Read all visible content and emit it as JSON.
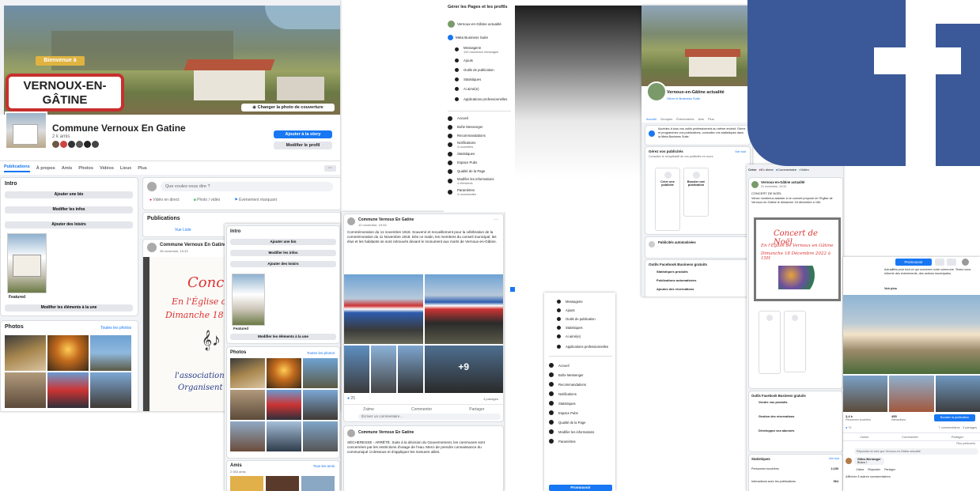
{
  "cover": {
    "welcome_sign": "Bienvenue à",
    "town_sign": "VERNOUX-EN-GÂTINE",
    "change_cover_btn": "Changer la photo de couverture"
  },
  "page1": {
    "page_name": "Commune Vernoux En Gatine",
    "likes": "2 k amis",
    "btn_story": "Ajouter à la story",
    "btn_edit": "Modifier le profil",
    "tabs": [
      "Publications",
      "À propos",
      "Amis",
      "Photos",
      "Vidéos",
      "Lieux",
      "Plus"
    ],
    "intro_title": "Intro",
    "intro_btns": [
      "Ajouter une bio",
      "Modifier les infos",
      "Ajouter des loisirs"
    ],
    "featured_label": "Featured",
    "featured_btn": "Modifier les éléments à la une",
    "photos_title": "Photos",
    "photos_link": "Toutes les photos",
    "composer_placeholder": "Que voulez-vous dire ?",
    "composer_actions": [
      "Vidéo en direct",
      "Photo / vidéo",
      "Évènement marquant"
    ],
    "publications_title": "Publications",
    "list_view": "Vue Liste",
    "post_author": "Commune Vernoux En Gatine",
    "post_date": "28 novembre, 19:33"
  },
  "flyer": {
    "title": "Concert de Noël",
    "line1": "En l'Église de Vernoux en Gâtine",
    "line2": "Dimanche 18 Décembre 2022 à 15H",
    "assoc": "l'association TOGAS",
    "organise": "Organisent ce concert"
  },
  "page2": {
    "intro_title": "Intro",
    "intro_btns": [
      "Ajouter une bio",
      "Modifier les infos",
      "Ajouter des loisirs"
    ],
    "featured_label": "Featured",
    "featured_btn": "Modifier les éléments à la une",
    "photos_title": "Photos",
    "photos_link": "Toutes les photos",
    "friends_title": "Amis",
    "friends_count": "2 063 amis",
    "friends_link": "Tous les amis"
  },
  "post3": {
    "author": "Commune Vernoux En Gatine",
    "date": "12 novembre, 19:33",
    "body": "Commémoration du 11 novembre 1918. Souvenir et recueillement pour la célébration de la commémoration du 11 Novembre 1918. Dès ce matin, les membres du conseil municipal, les élus et les habitants se sont retrouvés devant le monument aux morts de Vernoux-en-Gâtine.",
    "more_photos": "+9",
    "reactions": "25",
    "shares": "3 partages",
    "actions": [
      "J'aime",
      "Commenter",
      "Partager"
    ],
    "comment_placeholder": "Écrivez un commentaire…",
    "second_author": "Commune Vernoux En Gatine",
    "second_body": "SÉCHERESSE - ARRÊTÉ. Suite à la décision du Gouvernement, les communes sont concernées par les restrictions d'usage de l'eau. Merci de prendre connaissance du communiqué ci-dessous et d'appliquer les mesures utiles."
  },
  "manage": {
    "title": "Gérer les Pages et les profils",
    "profile": "Vernoux-en-Gâtine actualité",
    "business_suite": "Meta Business Suite",
    "items": [
      {
        "label": "Messagerie",
        "sub": "110 nouveaux messages"
      },
      {
        "label": "Ajouts",
        "sub": ""
      },
      {
        "label": "Outils de publication",
        "sub": ""
      },
      {
        "label": "Statistiques",
        "sub": ""
      },
      {
        "label": "Ai aimé(e)",
        "sub": ""
      },
      {
        "label": "Applications professionnelles",
        "sub": ""
      }
    ],
    "items2": [
      {
        "label": "Accueil",
        "sub": ""
      },
      {
        "label": "Boîte Messenger",
        "sub": ""
      },
      {
        "label": "Recommandations",
        "sub": "3 nouveautés"
      },
      {
        "label": "Notifications",
        "sub": "4 nouvelles"
      },
      {
        "label": "Statistiques",
        "sub": ""
      },
      {
        "label": "Espace Pubs",
        "sub": ""
      },
      {
        "label": "Qualité de la Page",
        "sub": ""
      },
      {
        "label": "Modifier les informations",
        "sub": "4 éléments"
      },
      {
        "label": "Paramètres",
        "sub": "4 nouveautés"
      }
    ]
  },
  "lowmenu": {
    "items": [
      "Messagerie",
      "Ajouts",
      "Outils de publication",
      "Statistiques",
      "Ai aimé(e)",
      "Applications professionnelles",
      "Accueil",
      "Boîte Messenger",
      "Recommandations",
      "Notifications",
      "Statistiques",
      "Espace Pubs",
      "Qualité de la Page",
      "Modifier les informations",
      "Paramètres"
    ],
    "promote": "Promouvoir"
  },
  "page3": {
    "name": "Vernoux-en-Gâtine actualité",
    "subtitle": "Gérer le Business Suite",
    "tabs": [
      "Accueil",
      "Groupes",
      "Évènements",
      "Avis",
      "Plus"
    ],
    "notice": "Accédez à tous vos outils professionnels au même endroit. Gérez et programmez vos publications, consultez vos statistiques dans la Meta Business Suite.",
    "ads_title": "Gérez vos publicités",
    "ads_sub": "Consultez le récapitulatif de vos publicités en cours",
    "see_all": "Voir tout",
    "create_ad": "Créer une publicité",
    "boost_post": "Booster une publication",
    "reach_title": "Publicités automatisées",
    "tools_title": "Outils Facebook Business gratuits",
    "tools": [
      "Statistiques produits",
      "Publications automatisées",
      "Ajoutez des réservations"
    ]
  },
  "page4": {
    "create_row": [
      "Créer",
      "En direct",
      "Commentaire",
      "Vidéo"
    ],
    "post_author": "Vernoux-en-Gâtine actualité",
    "post_date": "21 novembre, 19:33",
    "post_title": "CONCERT DE NOËL",
    "post_body": "Venez nombreux assister à ce concert proposé en l'Église de Vernoux-en-Gâtine le dimanche 18 décembre à 15h.",
    "flyer_title": "Concert de Noël",
    "flyer_line1": "En l'Église de Vernoux en Gâtine",
    "flyer_line2": "Dimanche 18 Décembre 2022 à 15H",
    "tools_title": "Outils Facebook Business gratuits",
    "tools": [
      "Vendre vos produits",
      "Gestion des réservations",
      "Développez vos abonnés"
    ],
    "insights_title": "Statistiques",
    "insights_link": "Voir tout",
    "insights_rows": [
      {
        "label": "Personnes touchées",
        "value": "2,150"
      },
      {
        "label": "Interactions avec les publications",
        "value": "564"
      }
    ]
  },
  "page5": {
    "btn_primary": "Promouvoir",
    "intro_text": "Actualités pour tout ce qui concerne notre commune. Tenez-vous informé des événements, des actions municipales.",
    "see_more": "Voir plus",
    "metric1": "3,4 k",
    "metric1_label": "Personnes touchées",
    "metric2": "455",
    "metric2_label": "Interactions",
    "boost_btn": "Booster la publication",
    "reactions": "71",
    "comments": "7 commentaires",
    "shares": "3 partages",
    "actions": [
      "J'aime",
      "Commenter",
      "Partager"
    ],
    "relevant": "Plus pertinents",
    "comment_prompt": "Répondez en tant que Vernoux-en-Gâtine actualité",
    "commenter": "Gilles Berranger",
    "comment_text": "Bravo !",
    "comment_actions": [
      "J'aime",
      "Répondre",
      "Partager"
    ],
    "more_comments": "Afficher 5 autres commentaires"
  }
}
